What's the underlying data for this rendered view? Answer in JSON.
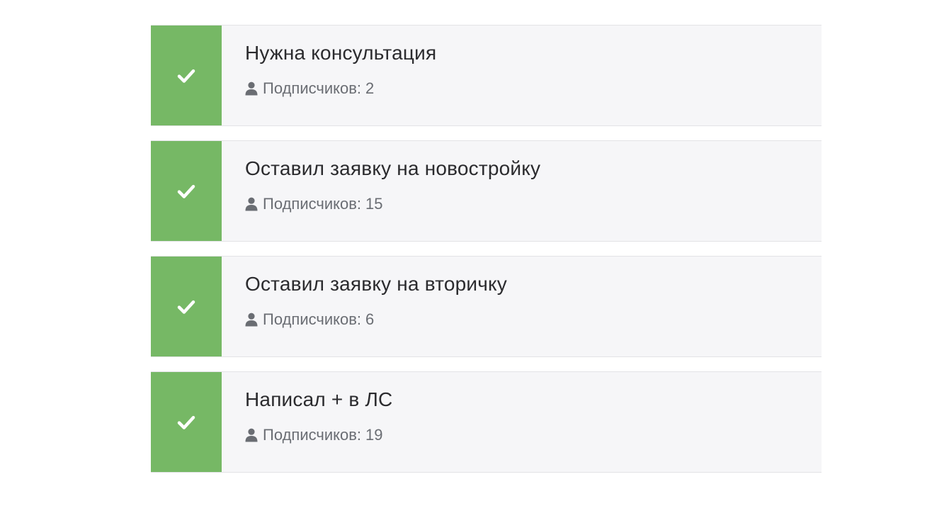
{
  "subscriber_label": "Подписчиков:",
  "colors": {
    "accent_green": "#76b865",
    "card_background": "#f6f6f8",
    "title_text": "#2b2b2e",
    "meta_text": "#6a6d73"
  },
  "icons": {
    "status": "check-icon",
    "subscribers": "user-icon"
  },
  "segments": [
    {
      "title": "Нужна консультация",
      "subscribers": "2",
      "selected": true
    },
    {
      "title": "Оставил заявку на новостройку",
      "subscribers": "15",
      "selected": true
    },
    {
      "title": "Оставил заявку на вторичку",
      "subscribers": "6",
      "selected": true
    },
    {
      "title": "Написал + в ЛС",
      "subscribers": "19",
      "selected": true
    }
  ]
}
